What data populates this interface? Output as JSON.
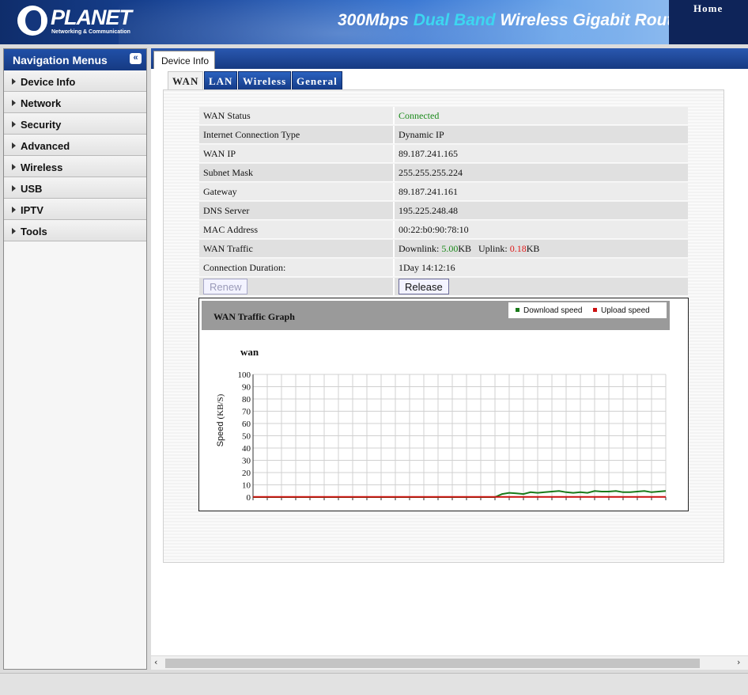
{
  "header": {
    "brand": "PLANET",
    "tagline": "Networking & Communication",
    "product_pre": "300Mbps ",
    "product_hl": "Dual Band",
    "product_post": " Wireless Gigabit Route",
    "home": "Home"
  },
  "sidebar": {
    "title": "Navigation Menus",
    "collapse_icon": "«",
    "items": [
      {
        "label": "Device Info"
      },
      {
        "label": "Network"
      },
      {
        "label": "Security"
      },
      {
        "label": "Advanced"
      },
      {
        "label": "Wireless"
      },
      {
        "label": "USB"
      },
      {
        "label": "IPTV"
      },
      {
        "label": "Tools"
      }
    ]
  },
  "page_tab": "Device Info",
  "subtabs": [
    "WAN",
    "LAN",
    "Wireless",
    "General"
  ],
  "wan": {
    "rows": [
      {
        "label": "WAN Status",
        "value": "Connected"
      },
      {
        "label": "Internet Connection Type",
        "value": "Dynamic IP"
      },
      {
        "label": "WAN IP",
        "value": "89.187.241.165"
      },
      {
        "label": "Subnet Mask",
        "value": "255.255.255.224"
      },
      {
        "label": "Gateway",
        "value": "89.187.241.161"
      },
      {
        "label": "DNS Server",
        "value": "195.225.248.48"
      },
      {
        "label": "MAC Address",
        "value": "00:22:b0:90:78:10"
      },
      {
        "label": "WAN Traffic",
        "value": ""
      },
      {
        "label": "Connection Duration:",
        "value": "1Day 14:12:16"
      }
    ],
    "traffic": {
      "downlink_label": "Downlink: ",
      "downlink_value": "5.00",
      "downlink_unit": "KB",
      "uplink_label": "Uplink: ",
      "uplink_value": "0.18",
      "uplink_unit": "KB"
    },
    "renew_label": "Renew",
    "release_label": "Release"
  },
  "graph": {
    "title": "WAN Traffic Graph",
    "legend_download": "Download speed",
    "legend_upload": "Upload speed",
    "series_label": "wan",
    "ylabel": "Speed",
    "yunit": "(KB/S)"
  },
  "colors": {
    "download": "#1a7a1a",
    "upload": "#cc1010",
    "accent": "#163a82"
  },
  "chart_data": {
    "type": "line",
    "ylim": [
      0,
      100
    ],
    "yticks": [
      0,
      10,
      20,
      30,
      40,
      50,
      60,
      70,
      80,
      90,
      100
    ],
    "grid": true,
    "legend": "top-right",
    "series": [
      {
        "name": "Download speed",
        "values": [
          0,
          0,
          0,
          0,
          0,
          0,
          0,
          0,
          0,
          0,
          0,
          0,
          0,
          0,
          0,
          0,
          0,
          0,
          0,
          0,
          0,
          0,
          0,
          0,
          0,
          0,
          0,
          0,
          0,
          0,
          0,
          0,
          0,
          0,
          0,
          2.5,
          3.5,
          3,
          2.5,
          4,
          3.5,
          4,
          4.5,
          5,
          4,
          3.5,
          4,
          3.5,
          5,
          4.5,
          4.5,
          5,
          4,
          4,
          4.5,
          5,
          4,
          4.5,
          5
        ]
      },
      {
        "name": "Upload speed",
        "values": [
          0.2,
          0.2,
          0.2,
          0.2,
          0.2,
          0.2,
          0.2,
          0.2,
          0.2,
          0.2,
          0.2,
          0.2,
          0.2,
          0.2,
          0.2,
          0.2,
          0.2,
          0.2,
          0.2,
          0.2,
          0.2,
          0.2,
          0.2,
          0.2,
          0.2,
          0.2,
          0.2,
          0.2,
          0.2,
          0.2,
          0.2,
          0.2,
          0.2,
          0.2,
          0.2,
          0.2,
          0.2,
          0.2,
          0.2,
          0.2,
          0.2,
          0.2,
          0.2,
          0.2,
          0.2,
          0.2,
          0.2,
          0.2,
          0.2,
          0.2,
          0.2,
          0.2,
          0.2,
          0.2,
          0.2,
          0.2,
          0.2,
          0.2,
          0.2
        ]
      }
    ]
  }
}
